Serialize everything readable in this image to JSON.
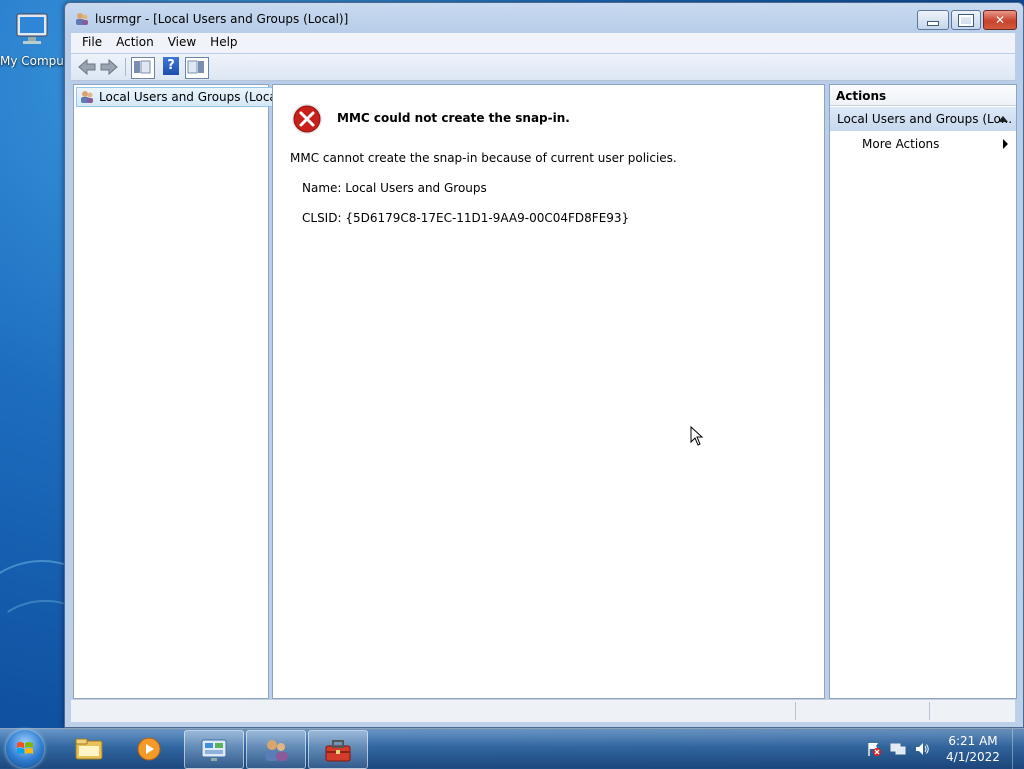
{
  "desktop": {
    "icon_label": "My Comput"
  },
  "window": {
    "title": "lusrmgr - [Local Users and Groups (Local)]",
    "controls": {
      "minimize": "minimize-icon",
      "maximize": "restore-icon",
      "close": "close-icon"
    }
  },
  "menu": [
    "File",
    "Action",
    "View",
    "Help"
  ],
  "toolbar": {
    "icons": [
      "back-arrow-icon",
      "forward-arrow-icon",
      "show-hide-console-tree-icon",
      "help-icon",
      "show-hide-action-pane-icon"
    ]
  },
  "tree": {
    "root_label": "Local Users and Groups (Local)"
  },
  "error": {
    "title": "MMC could not create the snap-in.",
    "message": "MMC cannot create the snap-in because of current user policies.",
    "name_line": "Name: Local Users and Groups",
    "clsid_line": "CLSID: {5D6179C8-17EC-11D1-9AA9-00C04FD8FE93}"
  },
  "actions": {
    "header": "Actions",
    "section_label": "Local Users and Groups (Lo...",
    "more_actions": "More Actions"
  },
  "taskbar": {
    "pinned": [
      "explorer-icon",
      "media-player-icon",
      "control-panel-icon",
      "users-icon",
      "toolbox-icon"
    ],
    "time": "6:21 AM",
    "date": "4/1/2022"
  },
  "colors": {
    "accent": "#1d6dbf",
    "close_button": "#c9432c",
    "error_red": "#c8201a"
  }
}
